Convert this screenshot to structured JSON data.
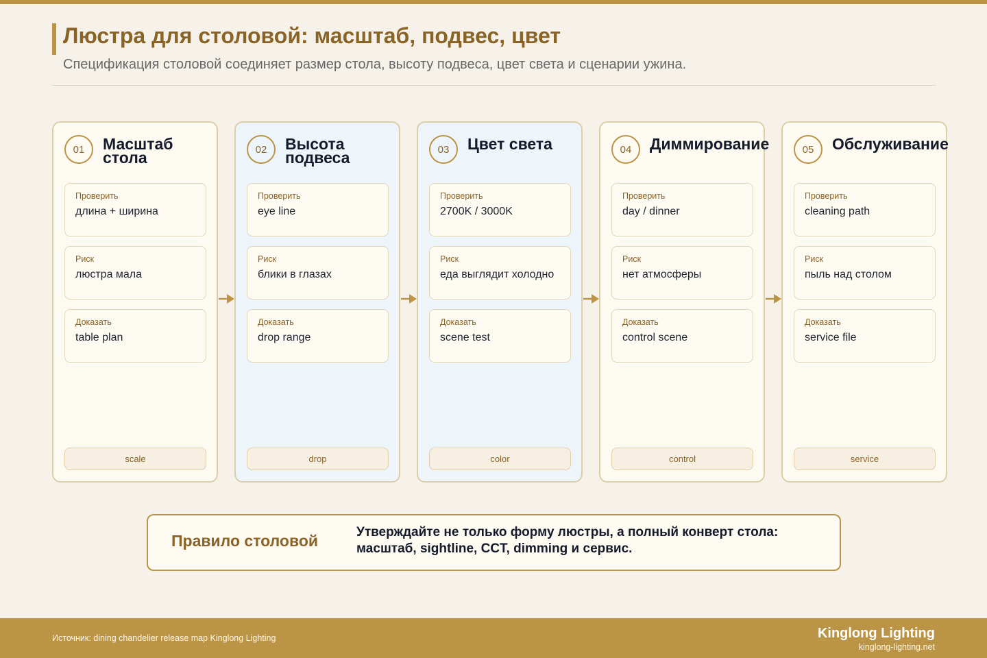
{
  "header": {
    "title": "Люстра для столовой: масштаб, подвес, цвет",
    "subtitle": "Спецификация столовой соединяет размер стола, высоту подвеса, цвет света и сценарии ужина."
  },
  "colors": {
    "accent": "#bb9446",
    "accent_dark": "#8a6426",
    "background": "#f6f2ea",
    "card_background": "#fdfaf2",
    "card_highlight": "#edf5fb"
  },
  "steps": [
    {
      "num": "01",
      "title": "Масштаб\nстола",
      "highlight": false,
      "items": [
        {
          "label": "Проверить",
          "value": "длина + ширина"
        },
        {
          "label": "Риск",
          "value": "люстра мала"
        },
        {
          "label": "Доказать",
          "value": "table plan"
        }
      ],
      "tag": "scale"
    },
    {
      "num": "02",
      "title": "Высота\nподвеса",
      "highlight": true,
      "items": [
        {
          "label": "Проверить",
          "value": "eye line"
        },
        {
          "label": "Риск",
          "value": "блики в глазах"
        },
        {
          "label": "Доказать",
          "value": "drop range"
        }
      ],
      "tag": "drop"
    },
    {
      "num": "03",
      "title": "Цвет света",
      "highlight": true,
      "items": [
        {
          "label": "Проверить",
          "value": "2700K / 3000K"
        },
        {
          "label": "Риск",
          "value": "еда выглядит холодно"
        },
        {
          "label": "Доказать",
          "value": "scene test"
        }
      ],
      "tag": "color"
    },
    {
      "num": "04",
      "title": "Диммирование",
      "highlight": false,
      "items": [
        {
          "label": "Проверить",
          "value": "day / dinner"
        },
        {
          "label": "Риск",
          "value": "нет атмосферы"
        },
        {
          "label": "Доказать",
          "value": "control scene"
        }
      ],
      "tag": "control"
    },
    {
      "num": "05",
      "title": "Обслуживание",
      "highlight": false,
      "items": [
        {
          "label": "Проверить",
          "value": "cleaning path"
        },
        {
          "label": "Риск",
          "value": "пыль над столом"
        },
        {
          "label": "Доказать",
          "value": "service file"
        }
      ],
      "tag": "service"
    }
  ],
  "arrow_icon": "arrow-right-icon",
  "rule": {
    "title": "Правило столовой",
    "text": "Утверждайте не только форму люстры, а полный конверт стола: масштаб, sightline, CCT, dimming и сервис."
  },
  "footer": {
    "source": "Источник: dining chandelier release map Kinglong Lighting",
    "brand": "Kinglong Lighting",
    "site": "kinglong-lighting.net"
  }
}
